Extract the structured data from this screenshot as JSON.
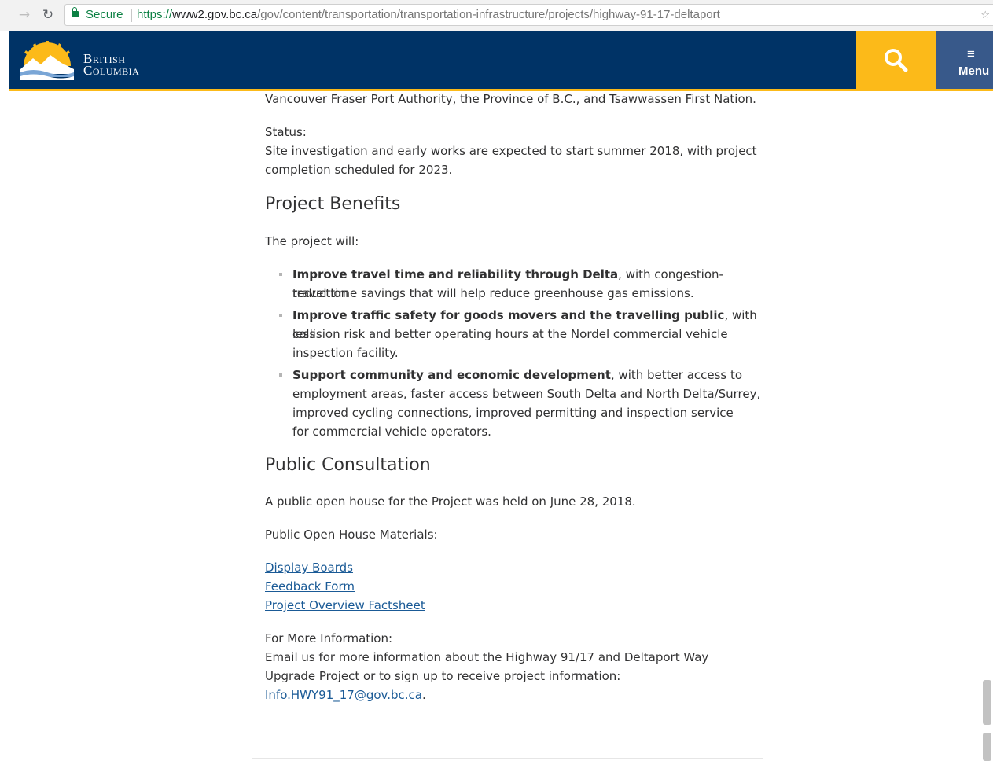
{
  "browser": {
    "secure_label": "Secure",
    "url_scheme": "https://",
    "url_host": "www2.gov.bc.ca",
    "url_path": "/gov/content/transportation/transportation-infrastructure/projects/highway-91-17-deltaport"
  },
  "header": {
    "logo_line1": "British",
    "logo_line2": "Columbia",
    "menu_label": "Menu",
    "colors": {
      "bar": "#003366",
      "search": "#fcba19",
      "menu": "#38598a",
      "accent": "#fcba19"
    }
  },
  "content": {
    "intro_tail": "Vancouver Fraser Port Authority, the Province of B.C., and Tsawwassen First Nation.",
    "status_label": "Status:",
    "status_text_line1": "Site investigation and early works are expected to start summer 2018, with project",
    "status_text_line2": "completion scheduled for 2023.",
    "benefits_heading": "Project Benefits",
    "benefits_intro": "The project will:",
    "benefits": [
      {
        "bold": "Improve travel time and reliability through Delta",
        "line1_rest": ", with congestion-reduction",
        "line2": "travel time savings that will help reduce greenhouse gas emissions."
      },
      {
        "bold": "Improve traffic safety for goods movers and the travelling public",
        "line1_rest": ", with less",
        "line2": "collision risk and better operating hours at the Nordel commercial vehicle",
        "line3": "inspection facility."
      },
      {
        "bold": "Support community and economic development",
        "line1_rest": ", with better access to",
        "line2": "employment areas, faster access between South Delta and North Delta/Surrey,",
        "line3": "improved cycling connections, improved permitting and inspection service",
        "line4": "for commercial vehicle operators."
      }
    ],
    "consultation_heading": "Public Consultation",
    "consultation_text": "A public open house for the Project was held on June 28, 2018.",
    "materials_label": "Public Open House Materials:",
    "links": {
      "display_boards": "Display Boards",
      "feedback_form": "Feedback Form",
      "factsheet": "Project Overview Factsheet"
    },
    "more_info_label": "For More Information:",
    "more_info_line1": "Email us for more information about the Highway 91/17 and Deltaport Way",
    "more_info_line2": "Upgrade Project or to sign up to receive project information:",
    "email": "Info.HWY91_17@gov.bc.ca",
    "email_trailing": "."
  }
}
